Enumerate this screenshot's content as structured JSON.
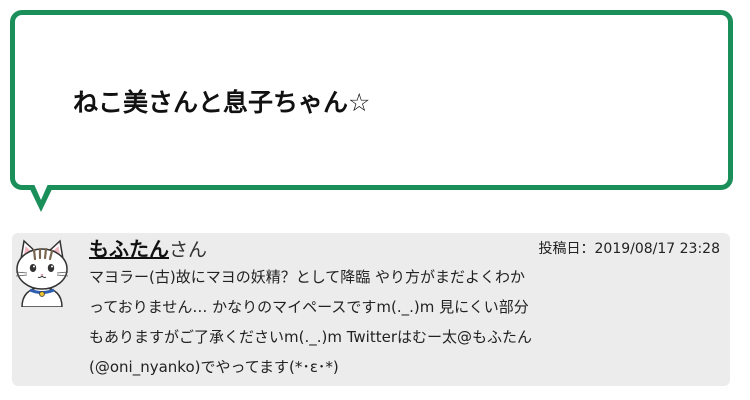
{
  "bubble": {
    "title": "ねこ美さんと息子ちゃん☆"
  },
  "author": {
    "name": "もふたん",
    "suffix": "さん",
    "date": "投稿日：2019/08/17 23:28",
    "bio_lines": [
      "マヨラー(古)故にマヨの妖精？として降臨 やり方がまだよくわか",
      "っておりません… かなりのマイペースですm(._.)m 見にくい部分",
      "もありますがご了承くださいm(._.)m Twitterはむー太@もふたん",
      "(@oni_nyanko)でやってます(*･ε･*)"
    ]
  },
  "colors": {
    "accent": "#1a8f5a",
    "card_bg": "#ececec"
  },
  "icons": {
    "avatar": "cat-avatar-icon"
  }
}
